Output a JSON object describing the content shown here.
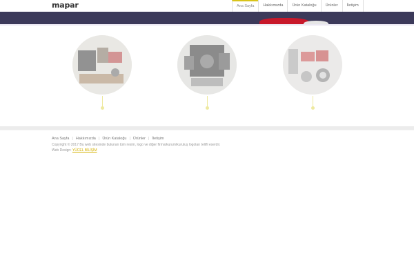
{
  "header": {
    "logo": "mapar",
    "nav": [
      {
        "label": "Ana Sayfa",
        "active": true
      },
      {
        "label": "Hakkımızda"
      },
      {
        "label": "Ürün Kataloğu"
      },
      {
        "label": "Ürünler"
      },
      {
        "label": "İletişim"
      }
    ]
  },
  "colors": {
    "banner": "#3c3a5a",
    "accent": "#d9c41a",
    "banner_red": "#c8182a"
  },
  "footer": {
    "links": [
      "Ana Sayfa",
      "Hakkımızda",
      "Ürün Kataloğu",
      "Ürünler",
      "İletişim"
    ],
    "copyright": "Copyright © 2017 Bu web sitesinde bulunan tüm resim, logo ve diğer firma/kurum/kuruluş logoları telifli eserdir.",
    "web_design_label": "Web Design:",
    "web_design_credit": "YÜCEL BİLİŞİM"
  }
}
